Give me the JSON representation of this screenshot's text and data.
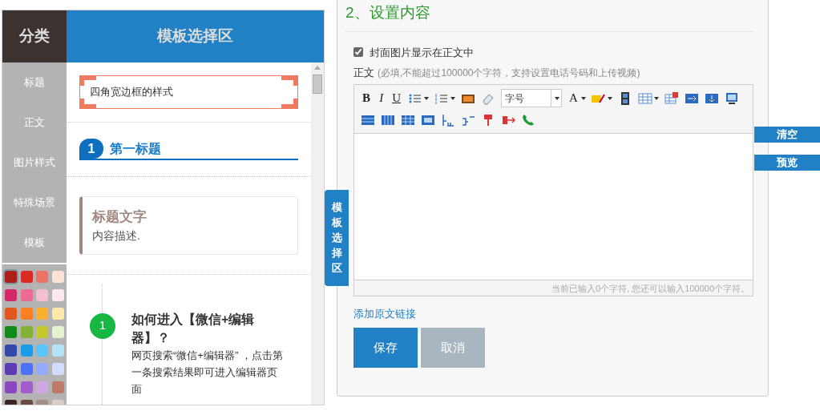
{
  "category_header": "分类",
  "template_header": "模板选择区",
  "categories": [
    {
      "label": "标题",
      "selected": false
    },
    {
      "label": "正文",
      "selected": false
    },
    {
      "label": "图片样式",
      "selected": false
    },
    {
      "label": "特殊场景",
      "selected": false
    },
    {
      "label": "模板",
      "selected": false
    }
  ],
  "swatches": [
    {
      "color": "#ad1f16",
      "selected": true
    },
    {
      "color": "#d92b24",
      "selected": false
    },
    {
      "color": "#ed7465",
      "selected": false
    },
    {
      "color": "#fde2d6",
      "selected": false
    },
    {
      "color": "#d4286a",
      "selected": false
    },
    {
      "color": "#eb6b96",
      "selected": false
    },
    {
      "color": "#f4bed1",
      "selected": false
    },
    {
      "color": "#fde8ef",
      "selected": false
    },
    {
      "color": "#e2571c",
      "selected": false
    },
    {
      "color": "#fb8024",
      "selected": false
    },
    {
      "color": "#fbb12b",
      "selected": false
    },
    {
      "color": "#fde9a8",
      "selected": false
    },
    {
      "color": "#128a19",
      "selected": false
    },
    {
      "color": "#82b135",
      "selected": false
    },
    {
      "color": "#c6c92b",
      "selected": false
    },
    {
      "color": "#e4f2cf",
      "selected": false
    },
    {
      "color": "#3549aa",
      "selected": false
    },
    {
      "color": "#1c9be6",
      "selected": false
    },
    {
      "color": "#5bc4f8",
      "selected": false
    },
    {
      "color": "#b5e4f9",
      "selected": false
    },
    {
      "color": "#5c3bb5",
      "selected": false
    },
    {
      "color": "#4c73f5",
      "selected": false
    },
    {
      "color": "#93abfb",
      "selected": false
    },
    {
      "color": "#d4dcfd",
      "selected": false
    },
    {
      "color": "#8b47c0",
      "selected": false
    },
    {
      "color": "#a35ccc",
      "selected": false
    },
    {
      "color": "#d0a7e3",
      "selected": false
    },
    {
      "color": "#be7a66",
      "selected": false
    },
    {
      "color": "#3b2520",
      "selected": false
    },
    {
      "color": "#6b4b40",
      "selected": false
    },
    {
      "color": "#a58e85",
      "selected": false
    },
    {
      "color": "#dccdc7",
      "selected": false
    }
  ],
  "templates": [
    {
      "kind": "corner_frame",
      "text": "四角宽边框的样式"
    },
    {
      "kind": "numbered_title",
      "number": "1",
      "text": "第一标题"
    },
    {
      "kind": "card",
      "title": "标题文字",
      "text": "内容描述."
    },
    {
      "kind": "step",
      "number": "1",
      "title": "如何进入【微信+编辑器】？",
      "text": "网页搜索“微信+编辑器” ，点击第一条搜索结果即可进入编辑器页面"
    }
  ],
  "side_tab": "模板选择区",
  "section_title": "2、设置内容",
  "cover_option": {
    "label": "封面图片显示在正文中",
    "checked": true
  },
  "body_label": "正文",
  "body_hint": "(必填,不能超过100000个字符，支持设置电话号码和上传视频)",
  "editor": {
    "toolbar_labels": [
      "B",
      "I",
      "U",
      "字号",
      "A"
    ],
    "counter": "当前已输入0个字符, 您还可以输入100000个字符。"
  },
  "side_buttons": [
    "清空",
    "预览"
  ],
  "link": "添加原文链接",
  "buttons": [
    {
      "label": "保存",
      "kind": "primary"
    },
    {
      "label": "取消",
      "kind": "secondary"
    }
  ]
}
